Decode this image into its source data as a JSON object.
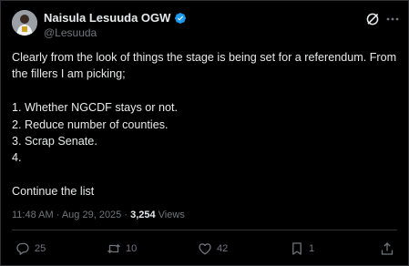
{
  "author": {
    "display_name": "Naisula Lesuuda OGW",
    "handle": "@Lesuuda",
    "verified": true
  },
  "tweet": {
    "text": "Clearly from the look of things the stage is being set for a referendum. From the fillers I am picking;\n\n1. Whether NGCDF stays or not.\n2. Reduce number of counties.\n3. Scrap Senate.\n4.\n\nContinue the list"
  },
  "meta": {
    "time": "11:48 AM",
    "date": "Aug 29, 2025",
    "separator": " · ",
    "views_count": "3,254",
    "views_label": "Views"
  },
  "actions": {
    "replies": "25",
    "reposts": "10",
    "likes": "42",
    "bookmarks": "1"
  },
  "icons": [
    "verified-badge-icon",
    "grok-icon",
    "more-icon",
    "reply-icon",
    "repost-icon",
    "like-icon",
    "bookmark-icon",
    "share-icon"
  ],
  "colors": {
    "background": "#000000",
    "text": "#e7e9ea",
    "secondary": "#71767b",
    "border": "#2f3336",
    "verified": "#1d9bf0"
  }
}
